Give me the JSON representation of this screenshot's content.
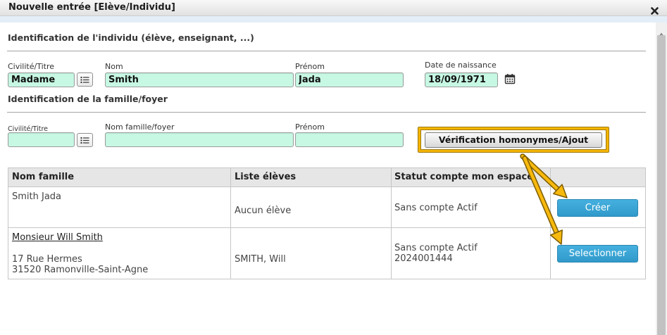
{
  "dialog": {
    "title": "Nouvelle entrée [Elève/Individu]"
  },
  "individual": {
    "heading": "Identification de l'individu (élève, enseignant, ...)",
    "civilite": {
      "label": "Civilité/Titre",
      "value": "Madame"
    },
    "nom": {
      "label": "Nom",
      "value": "Smith"
    },
    "prenom": {
      "label": "Prénom",
      "value": "Jada"
    },
    "date_naissance": {
      "label": "Date de naissance",
      "value": "18/09/1971"
    }
  },
  "family": {
    "heading": "Identification de la famille/foyer",
    "civilite": {
      "label": "Civilité/Titre",
      "value": ""
    },
    "nom": {
      "label": "Nom famille/foyer",
      "value": ""
    },
    "prenom": {
      "label": "Prénom",
      "value": ""
    },
    "check_button": "Vérification homonymes/Ajout"
  },
  "results_table": {
    "columns": [
      "Nom famille",
      "Liste élèves",
      "Statut compte mon espace"
    ],
    "rows": [
      {
        "name": "Smith Jada",
        "students": "Aucun élève",
        "status": "Sans compte Actif",
        "action": "Créer"
      },
      {
        "name": "Monsieur Will Smith",
        "address": [
          "17 Rue Hermes",
          "31520 Ramonville-Saint-Agne"
        ],
        "students": "SMITH, Will",
        "status": "Sans compte Actif",
        "account_number": "2024001444",
        "action": "Selectionner"
      }
    ]
  },
  "icons": {
    "close": "close-icon",
    "civilite_picker": "list-icon",
    "date_picker": "calendar-icon",
    "annotations": "arrow-icon",
    "scroll": "chevron-up-icon"
  },
  "colors": {
    "input_background": "#c7f8e4",
    "action_button": "#38a6d6",
    "annotation_highlight": "#f5b400",
    "table_header": "#e6e6e6",
    "titlebar": "#e8e8e8"
  }
}
